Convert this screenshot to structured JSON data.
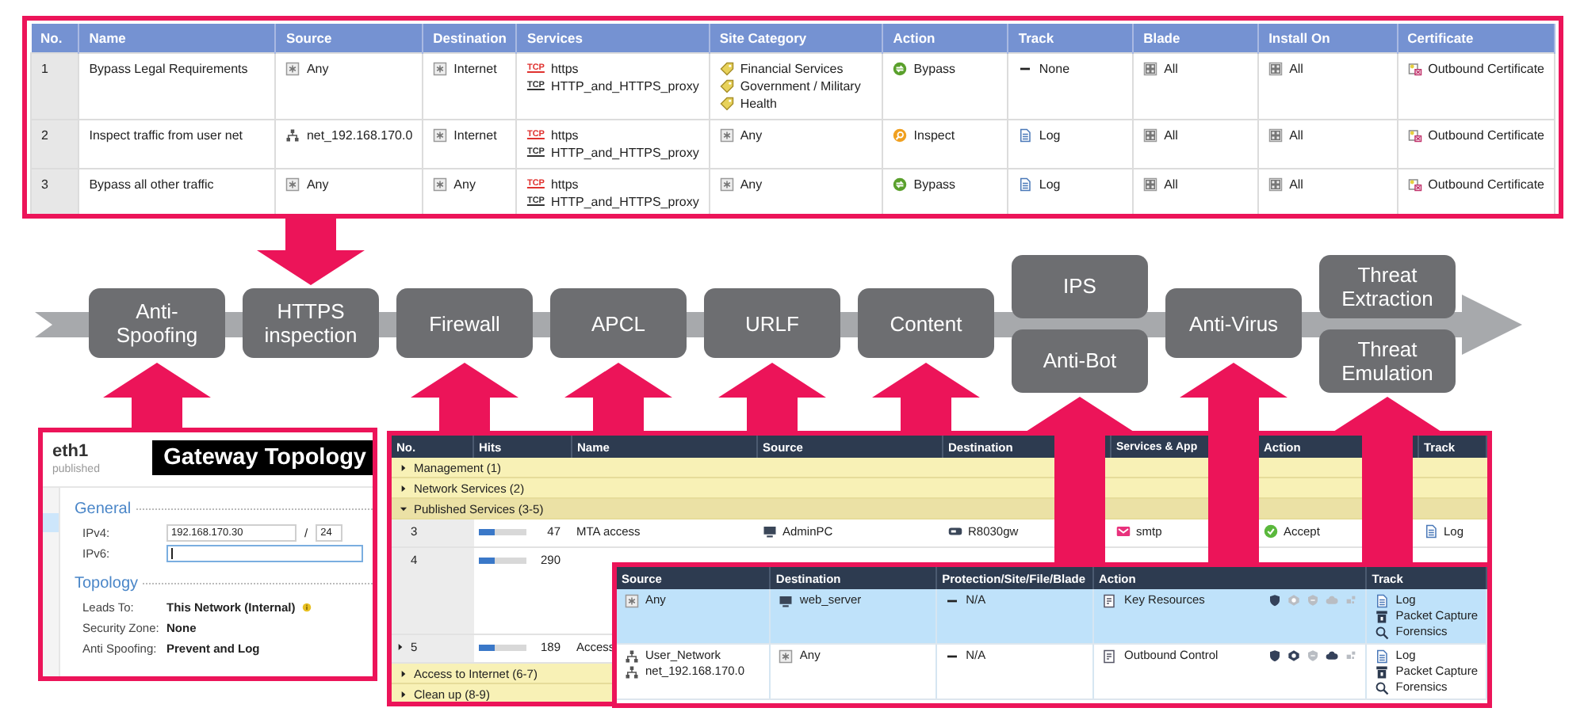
{
  "rulebase": {
    "columns": [
      "No.",
      "Name",
      "Source",
      "Destination",
      "Services",
      "Site Category",
      "Action",
      "Track",
      "Blade",
      "Install On",
      "Certificate"
    ],
    "rows": [
      {
        "cells": [
          [
            {
              "kind": "number",
              "text": "1"
            }
          ],
          [
            {
              "kind": "text",
              "text": "Bypass Legal Requirements"
            }
          ],
          [
            {
              "kind": "star",
              "text": "Any"
            }
          ],
          [
            {
              "kind": "star",
              "text": "Internet"
            }
          ],
          [
            {
              "kind": "service",
              "protocol": "TCP",
              "text": "https",
              "color": "#e0322f"
            },
            {
              "kind": "service",
              "protocol": "TCP",
              "text": "HTTP_and_HTTPS_proxy",
              "color": "#333333"
            }
          ],
          [
            {
              "kind": "category",
              "text": "Financial Services"
            },
            {
              "kind": "category",
              "text": "Government / Military"
            },
            {
              "kind": "category",
              "text": "Health"
            }
          ],
          [
            {
              "kind": "bypass",
              "text": "Bypass"
            }
          ],
          [
            {
              "kind": "none",
              "text": "None"
            }
          ],
          [
            {
              "kind": "all",
              "text": "All"
            }
          ],
          [
            {
              "kind": "all",
              "text": "All"
            }
          ],
          [
            {
              "kind": "certificate",
              "text": "Outbound Certificate"
            }
          ]
        ]
      },
      {
        "cells": [
          [
            {
              "kind": "number",
              "text": "2"
            }
          ],
          [
            {
              "kind": "text",
              "text": "Inspect traffic from user net"
            }
          ],
          [
            {
              "kind": "network",
              "text": "net_192.168.170.0"
            }
          ],
          [
            {
              "kind": "star",
              "text": "Internet"
            }
          ],
          [
            {
              "kind": "service",
              "protocol": "TCP",
              "text": "https",
              "color": "#e0322f"
            },
            {
              "kind": "service",
              "protocol": "TCP",
              "text": "HTTP_and_HTTPS_proxy",
              "color": "#333333"
            }
          ],
          [
            {
              "kind": "star",
              "text": "Any"
            }
          ],
          [
            {
              "kind": "inspect",
              "text": "Inspect"
            }
          ],
          [
            {
              "kind": "log",
              "text": "Log"
            }
          ],
          [
            {
              "kind": "all",
              "text": "All"
            }
          ],
          [
            {
              "kind": "all",
              "text": "All"
            }
          ],
          [
            {
              "kind": "certificate",
              "text": "Outbound Certificate"
            }
          ]
        ]
      },
      {
        "cells": [
          [
            {
              "kind": "number",
              "text": "3"
            }
          ],
          [
            {
              "kind": "text",
              "text": "Bypass all other traffic"
            }
          ],
          [
            {
              "kind": "star",
              "text": "Any"
            }
          ],
          [
            {
              "kind": "star",
              "text": "Any"
            }
          ],
          [
            {
              "kind": "service",
              "protocol": "TCP",
              "text": "https",
              "color": "#e0322f"
            },
            {
              "kind": "service",
              "protocol": "TCP",
              "text": "HTTP_and_HTTPS_proxy",
              "color": "#333333"
            }
          ],
          [
            {
              "kind": "star",
              "text": "Any"
            }
          ],
          [
            {
              "kind": "bypass",
              "text": "Bypass"
            }
          ],
          [
            {
              "kind": "log",
              "text": "Log"
            }
          ],
          [
            {
              "kind": "all",
              "text": "All"
            }
          ],
          [
            {
              "kind": "all",
              "text": "All"
            }
          ],
          [
            {
              "kind": "certificate",
              "text": "Outbound Certificate"
            }
          ]
        ]
      }
    ]
  },
  "pipeline": {
    "columns": [
      {
        "blades": [
          {
            "label": "Anti-Spoofing",
            "arrow_up": true,
            "arrow_down": false,
            "through_table": false
          }
        ]
      },
      {
        "blades": [
          {
            "label": "HTTPS inspection",
            "arrow_up": false,
            "arrow_down": true
          }
        ]
      },
      {
        "blades": [
          {
            "label": "Firewall",
            "arrow_up": true,
            "arrow_down": false,
            "through_table": false
          }
        ]
      },
      {
        "blades": [
          {
            "label": "APCL",
            "arrow_up": true,
            "arrow_down": false,
            "through_table": false
          }
        ]
      },
      {
        "blades": [
          {
            "label": "URLF",
            "arrow_up": true,
            "arrow_down": false,
            "through_table": false
          }
        ]
      },
      {
        "blades": [
          {
            "label": "Content",
            "arrow_up": true,
            "arrow_down": false,
            "through_table": false
          }
        ]
      },
      {
        "blades": [
          {
            "label": "IPS",
            "arrow_up": false,
            "arrow_down": false
          },
          {
            "label": "Anti-Bot",
            "arrow_up": true,
            "arrow_down": false,
            "through_table": true
          }
        ]
      },
      {
        "blades": [
          {
            "label": "Anti-Virus",
            "arrow_up": true,
            "arrow_down": false,
            "through_table": true
          }
        ]
      },
      {
        "blades": [
          {
            "label": "Threat Extraction",
            "arrow_up": false,
            "arrow_down": false
          },
          {
            "label": "Threat Emulation",
            "arrow_up": true,
            "arrow_down": false,
            "through_table": true
          }
        ]
      }
    ]
  },
  "topology_panel": {
    "title": "eth1",
    "status": "published",
    "banner": "Gateway Topology",
    "general": {
      "heading": "General",
      "ipv4": {
        "label": "IPv4:",
        "value": "192.168.170.30",
        "separator": "/",
        "mask": "24"
      },
      "ipv6": {
        "label": "IPv6:",
        "focused": true
      }
    },
    "topology": {
      "heading": "Topology",
      "fields": [
        {
          "label": "Leads To:",
          "value": "This Network (Internal)",
          "info": true
        },
        {
          "label": "Security Zone:",
          "value": "None",
          "info": false
        },
        {
          "label": "Anti Spoofing:",
          "value": "Prevent and Log",
          "info": false
        }
      ]
    }
  },
  "policy": {
    "columns": [
      "No.",
      "Hits",
      "Name",
      "Source",
      "Destination",
      "Services & App",
      "Action",
      "Track"
    ],
    "rows": [
      {
        "kind": "section",
        "label": "Management (1)",
        "expanded": false
      },
      {
        "kind": "section",
        "label": "Network Services (2)",
        "expanded": false
      },
      {
        "kind": "section",
        "label": "Published Services (3-5)",
        "expanded": true
      },
      {
        "kind": "rule",
        "no": "3",
        "expandable": false,
        "hits": "47",
        "level": 0.35,
        "cells": [
          [
            {
              "kind": "text",
              "text": "MTA access"
            }
          ],
          [
            {
              "kind": "host",
              "text": "AdminPC"
            }
          ],
          [
            {
              "kind": "gateway",
              "text": "R8030gw"
            }
          ],
          [
            {
              "kind": "mail",
              "text": "smtp"
            }
          ],
          [
            {
              "kind": "accept",
              "text": "Accept"
            }
          ],
          [
            {
              "kind": "log",
              "text": "Log"
            }
          ]
        ]
      },
      {
        "kind": "rule",
        "no": "4",
        "expandable": false,
        "hits": "290",
        "level": 0.35
      },
      {
        "kind": "rule",
        "no": "5",
        "expandable": true,
        "hits": "189",
        "level": 0.35,
        "cells": [
          [
            {
              "kind": "text",
              "text": "Access"
            }
          ]
        ]
      },
      {
        "kind": "section",
        "label": "Access to Internet (6-7)",
        "expanded": false
      },
      {
        "kind": "section",
        "label": "Clean up (8-9)",
        "expanded": false
      }
    ]
  },
  "rule_detail": {
    "columns": [
      "Source",
      "Destination",
      "Protection/Site/File/Blade",
      "Action",
      "Track"
    ],
    "rows": [
      {
        "selected": true,
        "source": [
          {
            "kind": "star",
            "text": "Any"
          }
        ],
        "destination": [
          {
            "kind": "host",
            "text": "web_server"
          }
        ],
        "protection": [
          {
            "kind": "none",
            "text": "N/A"
          }
        ],
        "action": {
          "kind": "layer",
          "text": "Key Resources"
        },
        "blades": [
          {
            "kind": "shield",
            "active": true
          },
          {
            "kind": "hexagon",
            "active": false
          },
          {
            "kind": "badge",
            "active": false
          },
          {
            "kind": "cloud",
            "active": false
          },
          {
            "kind": "squares",
            "active": false
          }
        ],
        "track": [
          {
            "kind": "log",
            "text": "Log"
          },
          {
            "kind": "capture",
            "text": "Packet Capture"
          },
          {
            "kind": "forensics",
            "text": "Forensics"
          }
        ]
      },
      {
        "selected": false,
        "source": [
          {
            "kind": "network",
            "text": "User_Network"
          },
          {
            "kind": "network",
            "text": "net_192.168.170.0"
          }
        ],
        "destination": [
          {
            "kind": "star",
            "text": "Any"
          }
        ],
        "protection": [
          {
            "kind": "none",
            "text": "N/A"
          }
        ],
        "action": {
          "kind": "layer",
          "text": "Outbound Control"
        },
        "blades": [
          {
            "kind": "shield",
            "active": true
          },
          {
            "kind": "hexagon",
            "active": true
          },
          {
            "kind": "badge",
            "active": false
          },
          {
            "kind": "cloud",
            "active": true
          },
          {
            "kind": "squares",
            "active": false
          }
        ],
        "track": [
          {
            "kind": "log",
            "text": "Log"
          },
          {
            "kind": "capture",
            "text": "Packet Capture"
          },
          {
            "kind": "forensics",
            "text": "Forensics"
          }
        ]
      }
    ]
  }
}
